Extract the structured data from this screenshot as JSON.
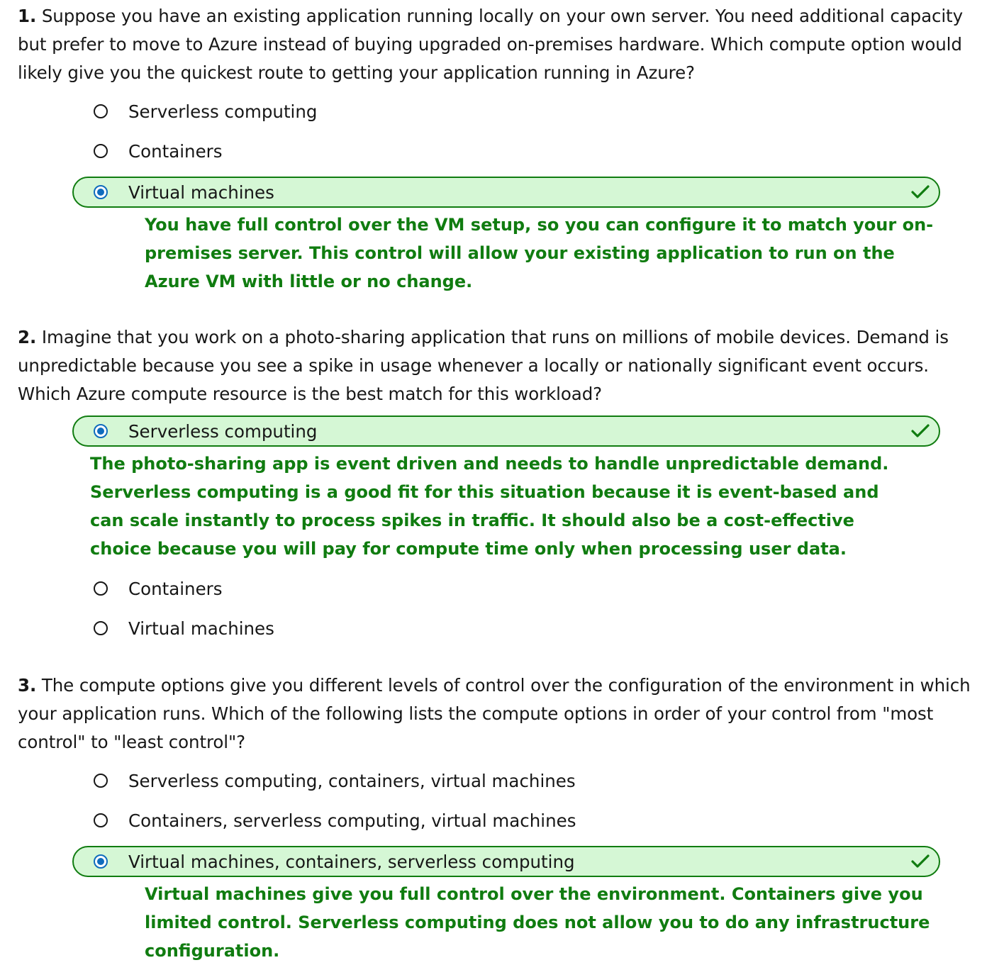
{
  "questions": [
    {
      "number": "1.",
      "text": "Suppose you have an existing application running locally on your own server. You need additional capacity but prefer to move to Azure instead of buying upgraded on-premises hardware. Which compute option would likely give you the quickest route to getting your application running in Azure?",
      "options": [
        {
          "label": "Serverless computing"
        },
        {
          "label": "Containers"
        },
        {
          "label": "Virtual machines",
          "selected": true
        }
      ],
      "feedback": "You have full control over the VM setup, so you can configure it to match your on-premises server. This control will allow your existing application to run on the Azure VM with little or no change."
    },
    {
      "number": "2.",
      "text": "Imagine that you work on a photo-sharing application that runs on millions of mobile devices. Demand is unpredictable because you see a spike in usage whenever a locally or nationally significant event occurs. Which Azure compute resource is the best match for this workload?",
      "options": [
        {
          "label": "Serverless computing",
          "selected": true
        },
        {
          "label": "Containers"
        },
        {
          "label": "Virtual machines"
        }
      ],
      "feedback": "The photo-sharing app is event driven and needs to handle unpredictable demand. Serverless computing is a good fit for this situation because it is event-based and can scale instantly to process spikes in traffic. It should also be a cost-effective choice because you will pay for compute time only when processing user data."
    },
    {
      "number": "3.",
      "text": "The compute options give you different levels of control over the configuration of the environment in which your application runs. Which of the following lists the compute options in order of your control from \"most control\" to \"least control\"?",
      "options": [
        {
          "label": "Serverless computing, containers, virtual machines"
        },
        {
          "label": "Containers, serverless computing, virtual machines"
        },
        {
          "label": "Virtual machines, containers, serverless computing",
          "selected": true
        }
      ],
      "feedback": "Virtual machines give you full control over the environment. Containers give you limited control. Serverless computing does not allow you to do any infrastructure configuration."
    }
  ],
  "colors": {
    "correct_green": "#107c10",
    "selected_bg": "#d5f7d5",
    "radio_blue": "#0f6cbd"
  },
  "icons": {
    "correct": "checkmark-icon",
    "radio_selected": "radio-selected-icon",
    "radio_unselected": "radio-unselected-icon"
  }
}
